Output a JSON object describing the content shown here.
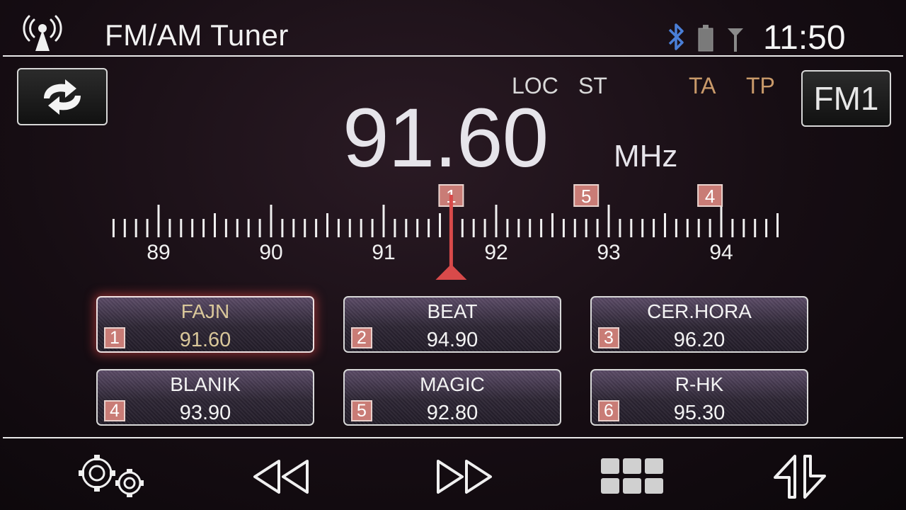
{
  "header": {
    "title": "FM/AM Tuner",
    "clock": "11:50",
    "icons": [
      "antenna-icon",
      "bluetooth-icon",
      "battery-icon",
      "signal-icon"
    ]
  },
  "tuner": {
    "band": "FM1",
    "frequency": "91.60",
    "unit": "MHz",
    "indicators": {
      "loc": "LOC",
      "st": "ST",
      "ta": "TA",
      "tp": "TP"
    },
    "scale": {
      "min": 88.6,
      "max": 94.5,
      "current": 91.6,
      "labels": [
        "89",
        "90",
        "91",
        "92",
        "93",
        "94"
      ],
      "markers": [
        {
          "label": "1",
          "freq": 91.6
        },
        {
          "label": "5",
          "freq": 92.8
        },
        {
          "label": "4",
          "freq": 93.9
        }
      ]
    }
  },
  "presets": [
    {
      "num": "1",
      "name": "FAJN",
      "freq": "91.60",
      "active": true
    },
    {
      "num": "2",
      "name": "BEAT",
      "freq": "94.90",
      "active": false
    },
    {
      "num": "3",
      "name": "CER.HORA",
      "freq": "96.20",
      "active": false
    },
    {
      "num": "4",
      "name": "BLANIK",
      "freq": "93.90",
      "active": false
    },
    {
      "num": "5",
      "name": "MAGIC",
      "freq": "92.80",
      "active": false
    },
    {
      "num": "6",
      "name": "R-HK",
      "freq": "95.30",
      "active": false
    }
  ],
  "toolbar": {
    "icons": [
      "settings-icon",
      "seek-back-icon",
      "seek-forward-icon",
      "grid-menu-icon",
      "swap-arrows-icon"
    ]
  },
  "colors": {
    "accent_red": "#d84a4a",
    "indicator_amber": "#c99a6a",
    "active_text": "#d9c79a"
  }
}
